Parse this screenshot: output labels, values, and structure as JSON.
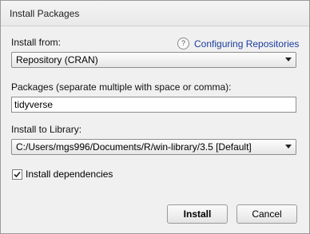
{
  "window": {
    "title": "Install Packages"
  },
  "install_from": {
    "label": "Install from:",
    "selected": "Repository (CRAN)"
  },
  "help": {
    "icon": "?",
    "link_text": "Configuring Repositories"
  },
  "packages": {
    "label": "Packages (separate multiple with space or comma):",
    "value": "tidyverse"
  },
  "library": {
    "label": "Install to Library:",
    "selected": "C:/Users/mgs996/Documents/R/win-library/3.5 [Default]"
  },
  "dependencies": {
    "label": "Install dependencies",
    "checked": true
  },
  "buttons": {
    "install": "Install",
    "cancel": "Cancel"
  }
}
